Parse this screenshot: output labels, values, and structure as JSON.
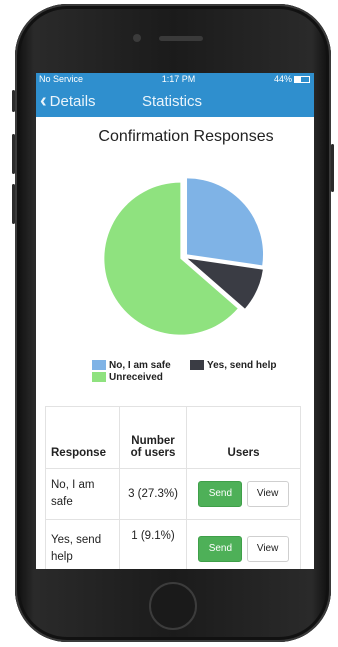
{
  "status_bar": {
    "carrier": "No Service",
    "time": "1:17 PM",
    "battery_text": "44%",
    "battery_level": 0.44
  },
  "nav": {
    "back_label": "Details",
    "title": "Statistics"
  },
  "chart_title": "Confirmation Responses",
  "legend": [
    {
      "label": "No, I am safe",
      "color": "#7fb3e6"
    },
    {
      "label": "Yes, send help",
      "color": "#3a3c44"
    },
    {
      "label": "Unreceived",
      "color": "#8fe27f"
    }
  ],
  "chart_data": {
    "type": "pie",
    "title": "Confirmation Responses",
    "slices": [
      {
        "label": "No, I am safe",
        "value": 27.3,
        "color": "#7fb3e6"
      },
      {
        "label": "Yes, send help",
        "value": 9.1,
        "color": "#3a3c44"
      },
      {
        "label": "Unreceived",
        "value": 63.6,
        "color": "#8fe27f"
      }
    ],
    "legend_position": "bottom"
  },
  "table": {
    "headers": {
      "response": "Response",
      "users_count": "Number of users",
      "users": "Users"
    },
    "rows": [
      {
        "response": "No, I am safe",
        "count": "3 (27.3%)",
        "send": "Send",
        "view": "View"
      },
      {
        "response": "Yes, send help",
        "count": "1 (9.1%)",
        "send": "Send",
        "view": "View"
      }
    ]
  },
  "colors": {
    "accent": "#2f8fce",
    "send_button": "#4eb058"
  }
}
